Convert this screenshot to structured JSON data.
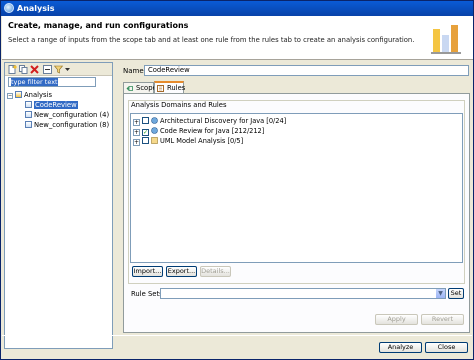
{
  "window": {
    "title": "Analysis"
  },
  "banner": {
    "heading": "Create, manage, and run configurations",
    "description": "Select a range of inputs from the scope tab and at least one rule from the rules tab to create an analysis configuration."
  },
  "left": {
    "filter_text": "type filter text",
    "tree": [
      {
        "label": "Analysis"
      },
      {
        "label": "CodeReview"
      },
      {
        "label": "New_configuration (4)"
      },
      {
        "label": "New_configuration (8)"
      }
    ]
  },
  "config": {
    "name_label": "Name:",
    "name_value": "CodeReview",
    "tabs": [
      {
        "label": "Scope"
      },
      {
        "label": "Rules"
      }
    ],
    "group_title": "Analysis Domains and Rules",
    "rules": [
      {
        "label": "Architectural Discovery for Java [0/24]",
        "checked": false
      },
      {
        "label": "Code Review for Java [212/212]",
        "checked": true
      },
      {
        "label": "UML Model Analysis [0/5]",
        "checked": false
      }
    ],
    "buttons": {
      "import": "Import...",
      "export": "Export...",
      "details": "Details..."
    },
    "rule_sets_label": "Rule Sets:",
    "set_button": "Set",
    "apply": "Apply",
    "revert": "Revert"
  },
  "footer": {
    "analyze": "Analyze",
    "close": "Close"
  }
}
